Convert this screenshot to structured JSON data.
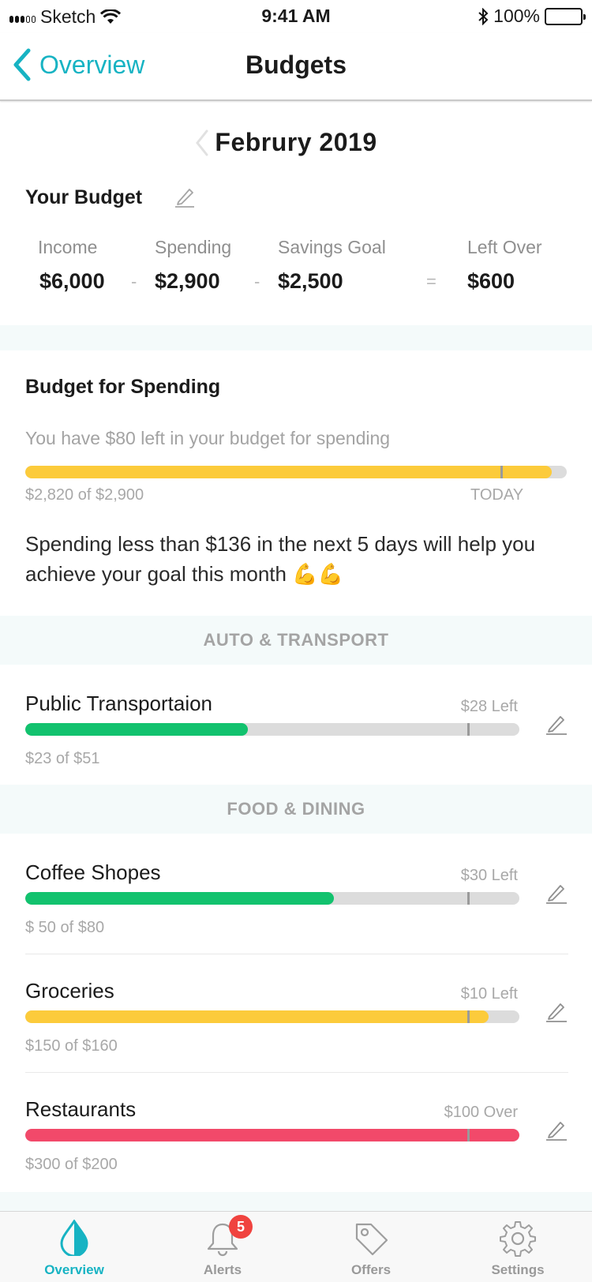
{
  "status_bar": {
    "carrier": "Sketch",
    "time": "9:41 AM",
    "battery": "100%"
  },
  "nav": {
    "back_label": "Overview",
    "title": "Budgets"
  },
  "month": {
    "label": "Februry 2019"
  },
  "your_budget": {
    "title": "Your Budget",
    "items": [
      {
        "label": "Income",
        "value": "$6,000"
      },
      {
        "label": "Spending",
        "value": "$2,900"
      },
      {
        "label": "Savings Goal",
        "value": "$2,500"
      },
      {
        "label": "Left Over",
        "value": "$600"
      }
    ],
    "operators": [
      "-",
      "-",
      "="
    ]
  },
  "spending_budget": {
    "title": "Budget for Spending",
    "hint": "You have $80 left in your budget for spending",
    "progress_fraction": 0.9724,
    "today_fraction": 0.877,
    "amount_text": "$2,820 of $2,900",
    "today_label": "TODAY",
    "tip": "Spending less than $136 in the next 5 days will help you achieve your goal this month",
    "tip_emoji": "💪💪"
  },
  "categories": [
    {
      "header": "AUTO & TRANSPORT",
      "items": [
        {
          "name": "Public Transportaion",
          "status": "$28 Left",
          "amount": "$23 of $51",
          "progress_fraction": 0.451,
          "color": "#12c26e"
        }
      ]
    },
    {
      "header": "FOOD & DINING",
      "items": [
        {
          "name": "Coffee Shopes",
          "status": "$30 Left",
          "amount": "$ 50 of $80",
          "progress_fraction": 0.625,
          "color": "#12c26e"
        },
        {
          "name": "Groceries",
          "status": "$10 Left",
          "amount": "$150 of $160",
          "progress_fraction": 0.9375,
          "color": "#fccb3b"
        },
        {
          "name": "Restaurants",
          "status": "$100 Over",
          "amount": "$300 of $200",
          "progress_fraction": 1.0,
          "color": "#f2496a"
        }
      ]
    }
  ],
  "tabs": [
    {
      "label": "Overview",
      "icon": "drop-icon",
      "active": true
    },
    {
      "label": "Alerts",
      "icon": "bell-icon",
      "badge": "5"
    },
    {
      "label": "Offers",
      "icon": "tag-icon"
    },
    {
      "label": "Settings",
      "icon": "gear-icon"
    }
  ],
  "colors": {
    "accent": "#17b3c3",
    "progress_yellow": "#fccb3b",
    "progress_green": "#12c26e",
    "progress_red": "#f2496a",
    "badge": "#f0433f"
  }
}
